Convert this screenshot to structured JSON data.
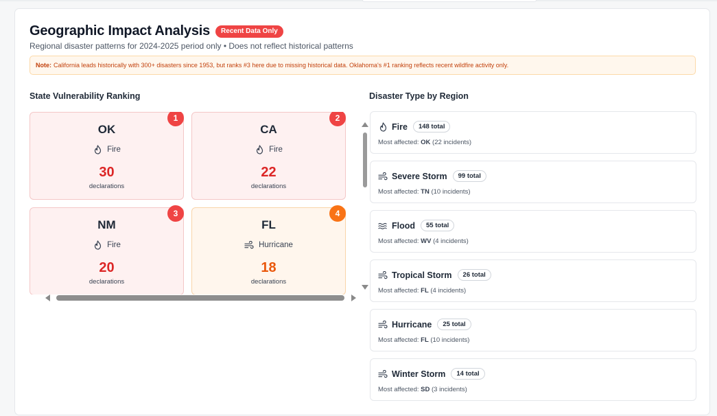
{
  "header": {
    "title": "Geographic Impact Analysis",
    "badge": "Recent Data Only",
    "subtitle": "Regional disaster patterns for 2024-2025 period only • Does not reflect historical patterns"
  },
  "note": {
    "label": "Note:",
    "text": "California leads historically with 300+ disasters since 1953, but ranks #3 here due to missing historical data. Oklahoma's #1 ranking reflects recent wildfire activity only."
  },
  "ranking": {
    "title": "State Vulnerability Ranking",
    "states": [
      {
        "rank": "1",
        "code": "OK",
        "type": "Fire",
        "icon": "flame-icon",
        "count": "30",
        "label": "declarations"
      },
      {
        "rank": "2",
        "code": "CA",
        "type": "Fire",
        "icon": "flame-icon",
        "count": "22",
        "label": "declarations"
      },
      {
        "rank": "3",
        "code": "NM",
        "type": "Fire",
        "icon": "flame-icon",
        "count": "20",
        "label": "declarations"
      },
      {
        "rank": "4",
        "code": "FL",
        "type": "Hurricane",
        "icon": "wind-icon",
        "count": "18",
        "label": "declarations"
      }
    ]
  },
  "regions": {
    "title": "Disaster Type by Region",
    "items": [
      {
        "name": "Fire",
        "icon": "flame-icon",
        "total": "148 total",
        "most_label": "Most affected:",
        "state": "OK",
        "incidents": "(22 incidents)"
      },
      {
        "name": "Severe Storm",
        "icon": "wind-icon",
        "total": "99 total",
        "most_label": "Most affected:",
        "state": "TN",
        "incidents": "(10 incidents)"
      },
      {
        "name": "Flood",
        "icon": "waves-icon",
        "total": "55 total",
        "most_label": "Most affected:",
        "state": "WV",
        "incidents": "(4 incidents)"
      },
      {
        "name": "Tropical Storm",
        "icon": "wind-icon",
        "total": "26 total",
        "most_label": "Most affected:",
        "state": "FL",
        "incidents": "(4 incidents)"
      },
      {
        "name": "Hurricane",
        "icon": "wind-icon",
        "total": "25 total",
        "most_label": "Most affected:",
        "state": "FL",
        "incidents": "(10 incidents)"
      },
      {
        "name": "Winter Storm",
        "icon": "wind-icon",
        "total": "14 total",
        "most_label": "Most affected:",
        "state": "SD",
        "incidents": "(3 incidents)"
      }
    ]
  },
  "colors": {
    "accent_red": "#ef4444",
    "accent_orange": "#f97316"
  }
}
